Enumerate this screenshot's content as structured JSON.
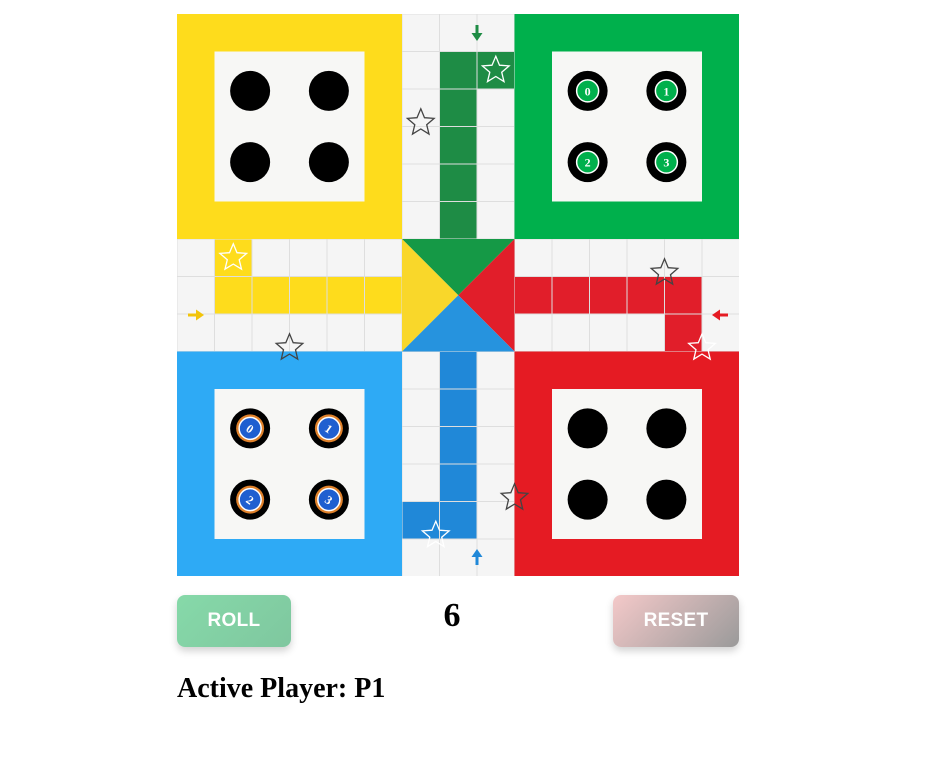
{
  "colors": {
    "yellow": "#fedc1c",
    "green": "#00b04c",
    "green_path": "#1e8c45",
    "green_center": "#159946",
    "red": "#e51b23",
    "red_path": "#e11e2a",
    "blue": "#2eaaf5",
    "blue_path": "#2088d8",
    "blue_center": "#2693de",
    "yellow_path": "#fedc1c",
    "yellow_center": "#f9d72a",
    "cell": "#f5f5f5",
    "inner": "#f7f7f5",
    "token_black": "#000000"
  },
  "board": {
    "yellow_home_tokens": [
      "",
      "",
      "",
      ""
    ],
    "green_home_tokens": [
      "0",
      "1",
      "2",
      "3"
    ],
    "blue_home_tokens": [
      "0",
      "1",
      "2",
      "3"
    ],
    "red_home_tokens": [
      "",
      "",
      "",
      ""
    ],
    "arrows": {
      "green": "down",
      "yellow": "right",
      "red": "left",
      "blue": "up"
    }
  },
  "controls": {
    "roll_label": "ROLL",
    "reset_label": "RESET",
    "dice_value": "6"
  },
  "status": {
    "active_player_text": "Active Player: P1"
  }
}
